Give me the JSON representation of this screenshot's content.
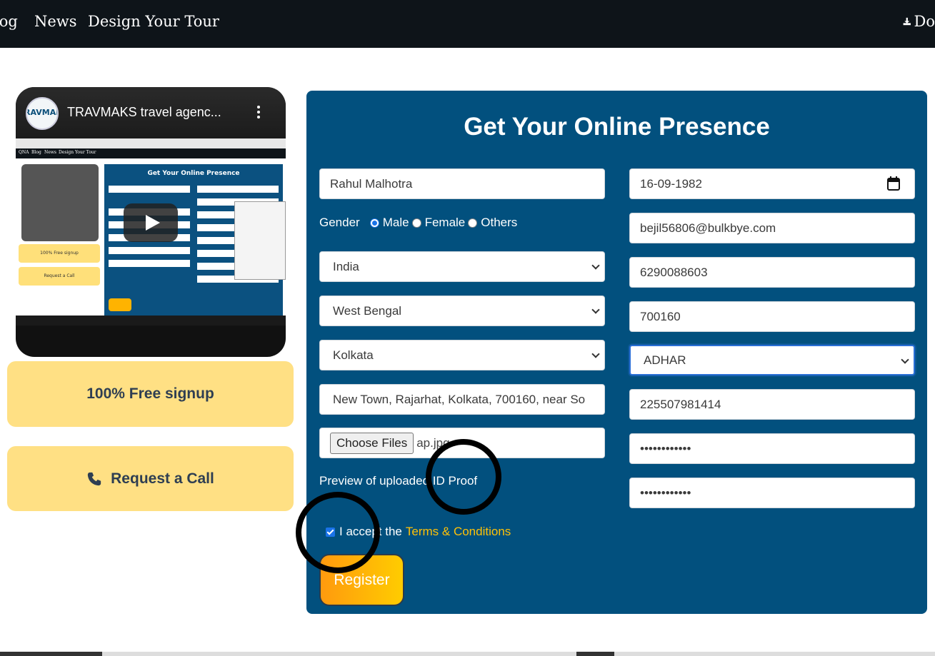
{
  "nav": {
    "blog": "log",
    "news": "News",
    "design_tour": "Design Your Tour",
    "download": "Do"
  },
  "video": {
    "logo_text": "RAVMAKS",
    "title": "TRAVMAKS travel agenc...",
    "inner_title": "Get Your Online Presence",
    "inner_free": "100% Free signup",
    "inner_call": "Request a Call"
  },
  "sidebar": {
    "free_signup": "100% Free signup",
    "request_call": "Request a Call"
  },
  "form": {
    "title": "Get Your Online Presence",
    "name": "Rahul Malhotra",
    "dob": "16-09-1982",
    "gender_label": "Gender",
    "gender_options": [
      "Male",
      "Female",
      "Others"
    ],
    "gender_selected": "Male",
    "email": "bejil56806@bulkbye.com",
    "country": "India",
    "phone": "6290088603",
    "state": "West Bengal",
    "pincode": "700160",
    "city": "Kolkata",
    "id_type": "ADHAR",
    "address": "New Town, Rajarhat, Kolkata, 700160, near So",
    "id_number": "225507981414",
    "file_button": "Choose Files",
    "file_name": "ap.jpg",
    "password": "••••••••••••",
    "confirm_password": "••••••••••••",
    "preview_label": "Preview of uploaded ID Proof",
    "terms_prefix": "I accept the",
    "terms_link": "Terms & Conditions",
    "terms_checked": true,
    "register": "Register"
  },
  "colors": {
    "nav_bg": "#0e1419",
    "panel_bg": "#02507e",
    "yellow": "#ffe084",
    "link": "#ffc107"
  }
}
